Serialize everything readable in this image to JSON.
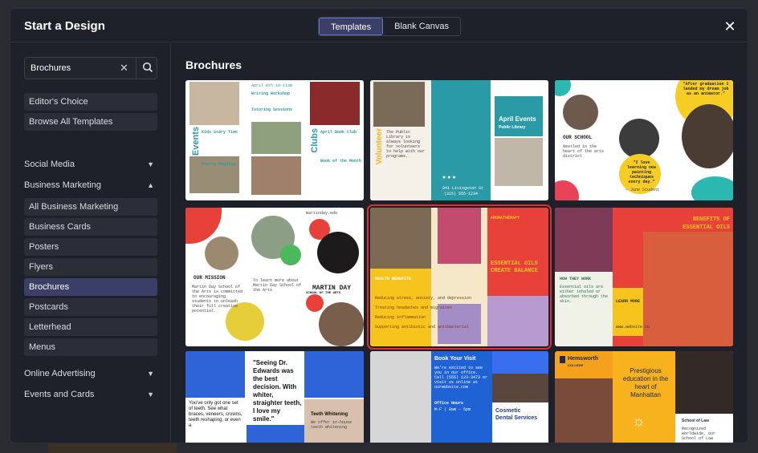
{
  "modal": {
    "title": "Start a Design",
    "tabs": [
      {
        "label": "Templates",
        "active": true
      },
      {
        "label": "Blank Canvas",
        "active": false
      }
    ]
  },
  "sidebar": {
    "search_value": "Brochures",
    "quick_links": [
      "Editor's Choice",
      "Browse All Templates"
    ],
    "categories": [
      {
        "label": "Social Media",
        "expanded": false
      },
      {
        "label": "Business Marketing",
        "expanded": true
      },
      {
        "label": "Online Advertising",
        "expanded": false
      },
      {
        "label": "Events and Cards",
        "expanded": false
      }
    ],
    "business_items": [
      "All Business Marketing",
      "Business Cards",
      "Posters",
      "Flyers",
      "Brochures",
      "Postcards",
      "Letterhead",
      "Menus"
    ],
    "selected_item": "Brochures"
  },
  "main": {
    "title": "Brochures",
    "templates": [
      {
        "heads": [
          "Events",
          "Clubs"
        ],
        "lines": [
          "April 8th 10-11am",
          "Writing Workshop",
          "Kids Story Time",
          "Tutoring Sessions",
          "April Book Club",
          "Poetry Reading",
          "Book of the Month"
        ]
      },
      {
        "heads": [
          "Volunteer",
          "April Events",
          "Public Library"
        ],
        "lines": [
          "The Public Library is always looking for volunteers to help with our programs.",
          "841 Livingston St",
          "(325) 555-1234"
        ]
      },
      {
        "heads": [
          "OUR SCHOOL",
          "\"After graduation I landed my dream job as an animator.\"",
          "\"I love learning new painting techniques every day.\""
        ],
        "lines": [
          "Nestled in the heart of the arts district",
          "— Jane Student"
        ]
      },
      {
        "heads": [
          "OUR MISSION",
          "MARTIN DAY",
          "SCHOOL OF THE ARTS"
        ],
        "lines": [
          "Martin Day School of the Arts is committed to encouraging students to unleash their full creative potential.",
          "To learn more about Martin Day School of the Arts",
          "martinday.edu"
        ]
      },
      {
        "heads": [
          "AROMATHERAPY",
          "ESSENTIAL OILS CREATE BALANCE",
          "HEALTH BENEFITS"
        ],
        "lines": [
          "Reducing stress, anxiety, and depression",
          "Treating headaches and migraines",
          "Reducing inflammation",
          "Supporting antibiotic and antibacterial"
        ]
      },
      {
        "heads": [
          "BENEFITS OF ESSENTIAL OILS",
          "HOW THEY WORK",
          "LEARN MORE"
        ],
        "lines": [
          "Essential oils are either inhaled or absorbed through the skin.",
          "www.website.co"
        ]
      },
      {
        "heads": [
          "\"Seeing Dr. Edwards was the best decision. With whiter, straighter teeth, I love my smile.\"",
          "Teeth Whitening"
        ],
        "lines": [
          "You've only got one set of teeth. See what braces, veneers, crowns, teeth reshaping, or even a",
          "We offer in-house teeth whitening"
        ]
      },
      {
        "heads": [
          "Book Your Visit",
          "Cosmetic Dental Services"
        ],
        "lines": [
          "We're excited to see you in our office. Call (555) 123-3473 or visit us online at ourwebsite.com",
          "Office Hours",
          "M-F | 8am - 5pm"
        ]
      },
      {
        "heads": [
          "Hemsworth",
          "COLLEGE",
          "Prestigious education in the heart of Manhattan",
          "School of Law"
        ],
        "lines": [
          "Recognized worldwide, our School of Law"
        ]
      }
    ]
  },
  "colors": {
    "modal_bg": "#1f212a",
    "selected_bg": "#3b3f68",
    "accent": "#6b72c9",
    "highlight": "#d9322c",
    "teal": "#2a9aa6",
    "red": "#e8413a",
    "yellow": "#f2c21b"
  }
}
